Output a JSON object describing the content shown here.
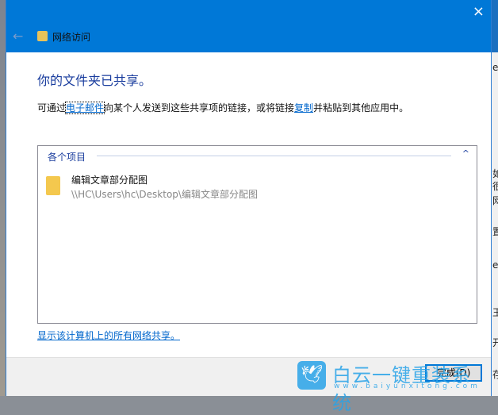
{
  "window": {
    "title": "网络访问",
    "close_icon": "×",
    "back_icon": "←"
  },
  "heading": "你的文件夹已共享。",
  "description": {
    "part1": "可通过",
    "email_link": "电子邮件",
    "part2": "向某个人发送到这些共享项的链接，或将链接",
    "copy_link": "复制",
    "part3": "并粘贴到其他应用中。"
  },
  "items_group": {
    "label": "各个项目",
    "collapse_icon": "^",
    "items": [
      {
        "name": "编辑文章部分配图",
        "path": "\\\\HC\\Users\\hc\\Desktop\\编辑文章部分配图",
        "icon": "folder-icon"
      }
    ]
  },
  "show_all_link": "显示该计算机上的所有网络共享。",
  "done_button": "完成(D)",
  "watermark": {
    "text": "白云一键重装系统",
    "url": "www.baiyunxitong.com"
  },
  "background_fragments": [
    "e",
    "如",
    "很",
    "网",
    "置",
    "e",
    "王",
    "开",
    "存"
  ]
}
